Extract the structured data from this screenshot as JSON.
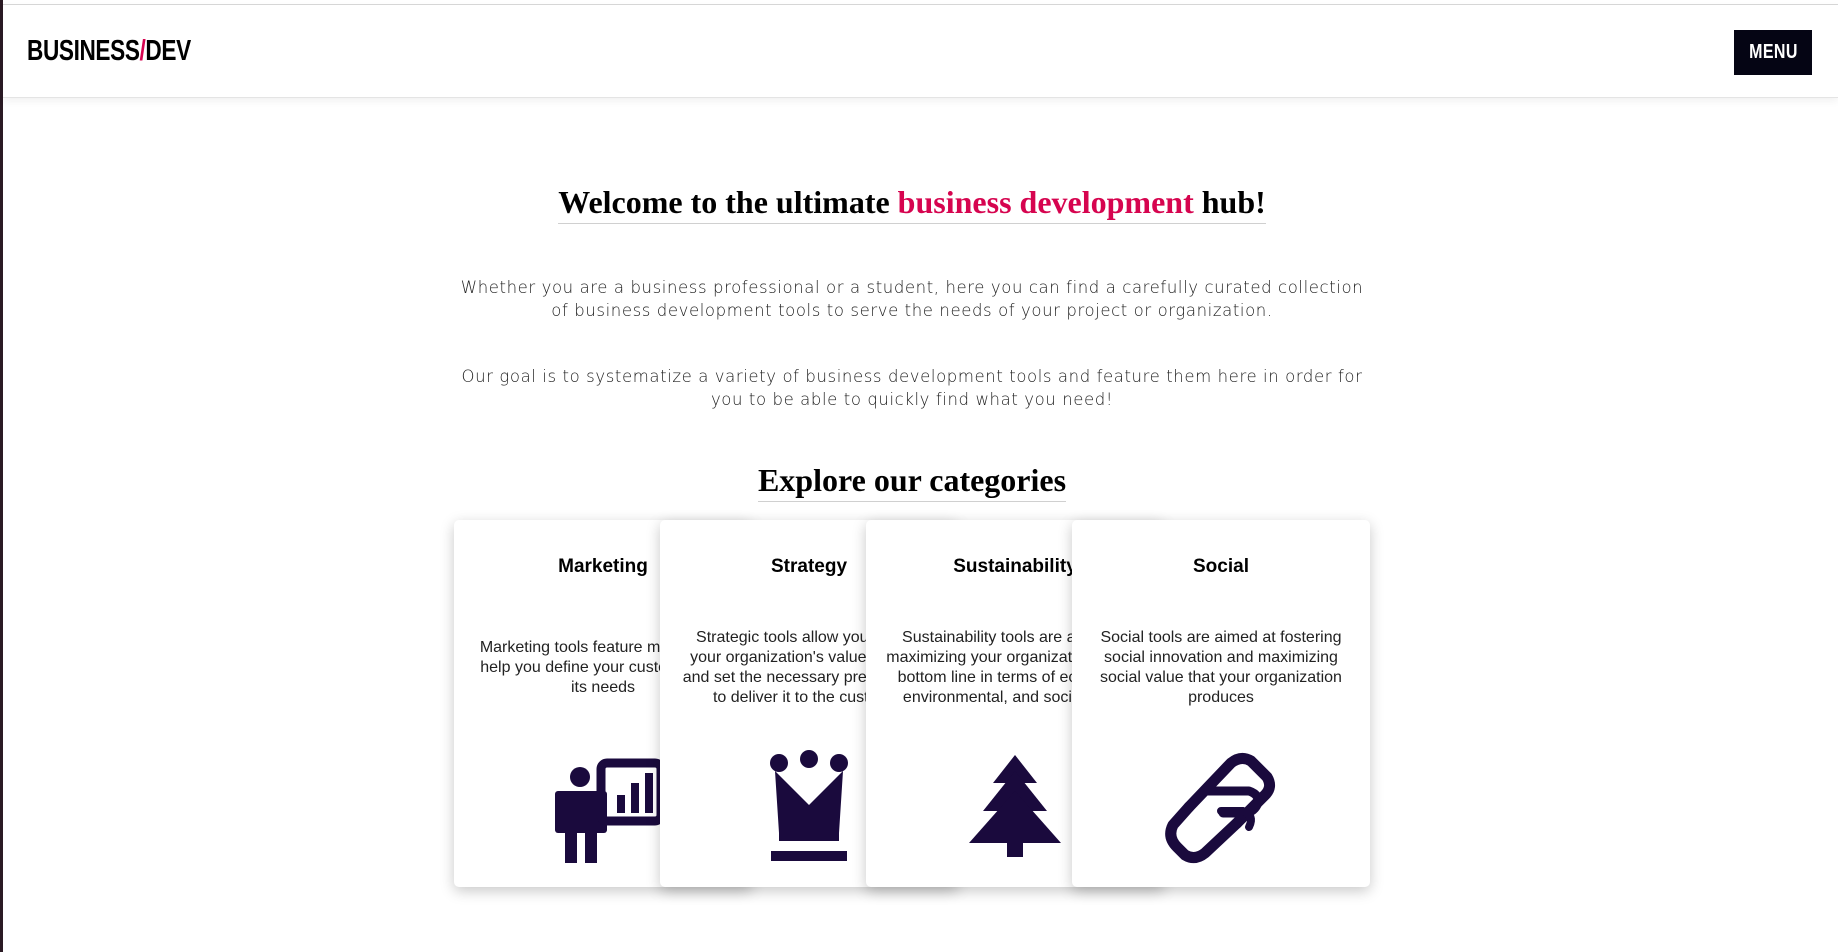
{
  "header": {
    "logo_left": "BUSINESS",
    "logo_slash": "/",
    "logo_right": "DEV",
    "menu_label": "MENU"
  },
  "hero": {
    "welcome_pre": "Welcome to the ultimate ",
    "welcome_accent": "business development",
    "welcome_post": " hub!",
    "paragraph1": "Whether you are a business professional or a student, here you can find a carefully curated collection of business development tools to serve the needs of your project or organization.",
    "paragraph2": "Our goal is to systematize a variety of business development tools and feature them here in order for you to be able to quickly find what you need!",
    "explore_title": "Explore our categories"
  },
  "categories": [
    {
      "title": "Marketing",
      "description": "Marketing tools feature methods to help you define your customer and its needs",
      "icon": "presentation-chart-icon"
    },
    {
      "title": "Strategy",
      "description": "Strategic tools allow you to map your organization's value creation and set the necessary prerequisites to deliver it to the customer",
      "icon": "chess-queen-icon"
    },
    {
      "title": "Sustainability",
      "description": "Sustainability tools are aimed at maximizing your organization's triple bottom line in terms of economic, environmental, and social value",
      "icon": "pine-tree-icon"
    },
    {
      "title": "Social",
      "description": "Social tools are aimed at fostering social innovation and maximizing social value that your organization produces",
      "icon": "handshake-icon"
    }
  ],
  "colors": {
    "accent": "#d6044f",
    "icon": "#1a0a3d",
    "menu_bg": "#050514"
  }
}
